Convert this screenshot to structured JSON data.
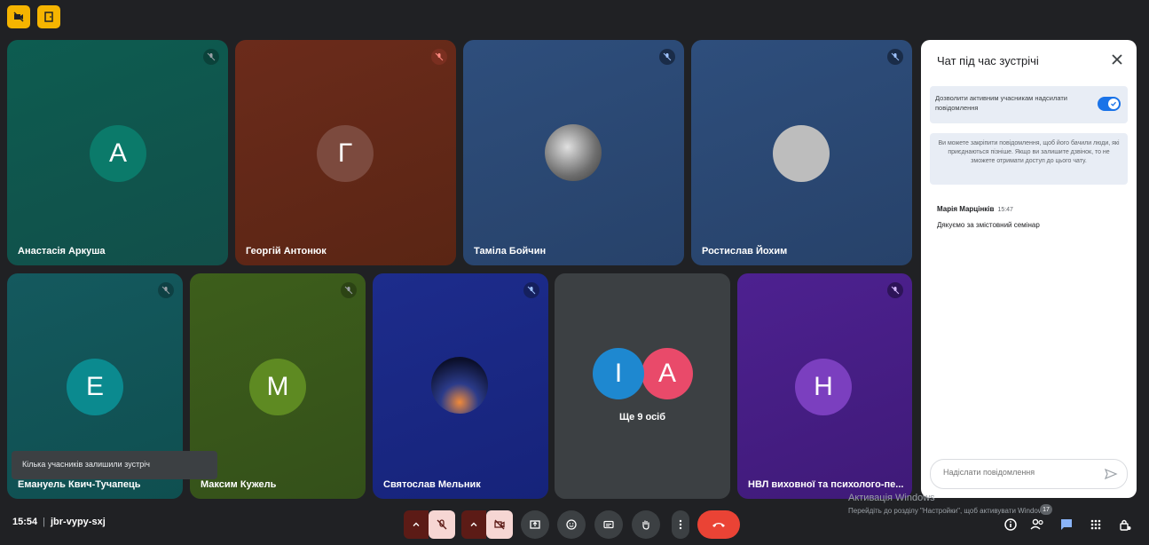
{
  "participants": [
    {
      "name": "Анастасія Аркуша",
      "initial": "А",
      "bg": "#0f5a52",
      "avatar": "#0b7a6a"
    },
    {
      "name": "Георгій Антонюк",
      "initial": "Г",
      "bg": "#6e2a1a",
      "avatar": "#7c4a3e"
    },
    {
      "name": "Таміла Бойчин",
      "initial": "",
      "bg": "#2b4b7a",
      "avatar": "#c0c0c0"
    },
    {
      "name": "Ростислав Йохим",
      "initial": "",
      "bg": "#2b4b7a",
      "avatar": "#bdbdbd"
    },
    {
      "name": "Емануель Квич-Тучапець",
      "initial": "Е",
      "bg": "#135a5f",
      "avatar": "#0b8a8f"
    },
    {
      "name": "Максим Кужель",
      "initial": "М",
      "bg": "#3a5a1a",
      "avatar": "#5e8a22"
    },
    {
      "name": "Святослав Мельник",
      "initial": "",
      "bg": "#1b2a8a",
      "avatar": "#2a3a7a"
    },
    {
      "name": "НВЛ виховної та психолого-пе...",
      "initial": "Н",
      "bg": "#4a1f8a",
      "avatar": "#7b3fbf"
    }
  ],
  "others": {
    "label": "Ще 9 осіб",
    "initial1": "І",
    "initial2": "А",
    "color1": "#1e88d0",
    "color2": "#e94a6a"
  },
  "chat": {
    "title": "Чат під час зустрічі",
    "allow_text": "Дозволити активним учасникам надсилати повідомлення",
    "info_text": "Ви можете закріпити повідомлення, щоб його бачили люди, які приєднаються пізніше. Якщо ви залишите дзвінок, то не зможете отримати доступ до цього чату.",
    "message_author": "Марія Марцінків",
    "message_time": "15:47",
    "message_text": "Дякуємо за змістовний семінар",
    "input_placeholder": "Надіслати повідомлення"
  },
  "toast": "Кілька учасників залишили зустріч",
  "meeting": {
    "time": "15:54",
    "code": "jbr-vypy-sxj",
    "separator": "|"
  },
  "activation": {
    "line1": "Активація Windows",
    "line2": "Перейдіть до розділу \"Настройки\", щоб активувати Windows."
  },
  "people_count": "17",
  "colors": {
    "leave": "#ea4335",
    "muted_bg": "#f6d6d3",
    "muted_dark": "#5c1b16",
    "toolbar_btn": "#3c4043",
    "chat_icon": "#8ab4f8"
  }
}
